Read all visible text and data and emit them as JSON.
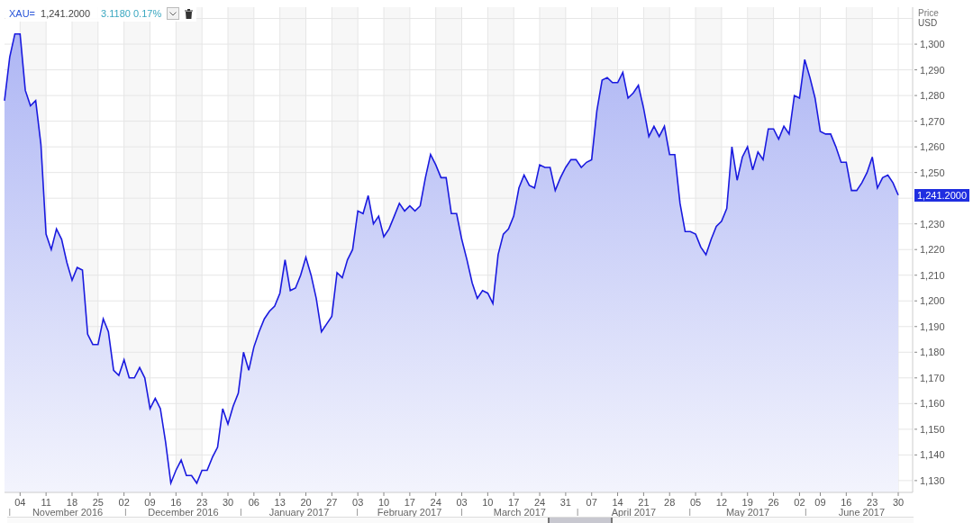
{
  "legend": {
    "price": "1,241.2000",
    "change": "3.1180 0.17%"
  },
  "price_axis": {
    "title": "Price",
    "unit": "USD"
  },
  "last_value_label": "1,241.2000",
  "chart_data": {
    "type": "area",
    "grid": true,
    "ylim": [
      1125.4,
      1314.4
    ],
    "categories": [
      null,
      null,
      null,
      "04",
      null,
      null,
      null,
      null,
      "11",
      null,
      null,
      null,
      null,
      "18",
      null,
      null,
      null,
      null,
      "25",
      null,
      null,
      null,
      null,
      "02",
      null,
      null,
      null,
      null,
      "09",
      null,
      null,
      null,
      null,
      "16",
      null,
      null,
      null,
      null,
      "23",
      null,
      null,
      null,
      null,
      "30",
      null,
      null,
      null,
      null,
      "06",
      null,
      null,
      null,
      null,
      "13",
      null,
      null,
      null,
      null,
      "20",
      null,
      null,
      null,
      null,
      "27",
      null,
      null,
      null,
      null,
      "03",
      null,
      null,
      null,
      null,
      "10",
      null,
      null,
      null,
      null,
      "17",
      null,
      null,
      null,
      null,
      "24",
      null,
      null,
      null,
      null,
      "03",
      null,
      null,
      null,
      null,
      "10",
      null,
      null,
      null,
      null,
      "17",
      null,
      null,
      null,
      null,
      "24",
      null,
      null,
      null,
      null,
      "31",
      null,
      null,
      null,
      null,
      "07",
      null,
      null,
      null,
      null,
      "14",
      null,
      null,
      null,
      null,
      "21",
      null,
      null,
      null,
      null,
      "28",
      null,
      null,
      null,
      null,
      "05",
      null,
      null,
      null,
      null,
      "12",
      null,
      null,
      null,
      null,
      "19",
      null,
      null,
      null,
      null,
      "26",
      null,
      null,
      null,
      null,
      "02",
      null,
      null,
      null,
      "09",
      null,
      null,
      null,
      null,
      "16",
      null,
      null,
      null,
      null,
      "23",
      null,
      null,
      null,
      null,
      "30"
    ],
    "series": [
      {
        "name": "XAU=",
        "color": "#1a1adf",
        "values": [
          1278,
          1295,
          1304,
          1304,
          1282,
          1276,
          1278,
          1261,
          1226,
          1220,
          1228,
          1224,
          1215,
          1208,
          1213,
          1212,
          1187,
          1183,
          1183,
          1193,
          1188,
          1173,
          1171,
          1177,
          1170,
          1170,
          1174,
          1170,
          1158,
          1162,
          1158,
          1145,
          1129,
          1134,
          1138,
          1132,
          1132,
          1129,
          1134,
          1134,
          1139,
          1143,
          1158,
          1152,
          1159,
          1164,
          1180,
          1173,
          1182,
          1188,
          1193,
          1196,
          1198,
          1203,
          1216,
          1204,
          1205,
          1210,
          1217,
          1210,
          1201,
          1188,
          1191,
          1194,
          1211,
          1209,
          1216,
          1220,
          1235,
          1234,
          1241,
          1230,
          1233,
          1225,
          1228,
          1233,
          1238,
          1235,
          1237,
          1235,
          1237,
          1248,
          1257,
          1253,
          1248,
          1248,
          1234,
          1234,
          1224,
          1216,
          1207,
          1201,
          1204,
          1203,
          1199,
          1218,
          1226,
          1228,
          1233,
          1244,
          1249,
          1245,
          1244,
          1253,
          1252,
          1252,
          1243,
          1248,
          1252,
          1255,
          1255,
          1252,
          1254,
          1255,
          1274,
          1286,
          1287,
          1285,
          1285,
          1289,
          1279,
          1281,
          1284,
          1275,
          1264,
          1268,
          1264,
          1268,
          1257,
          1257,
          1238,
          1227,
          1227,
          1226,
          1221,
          1218,
          1224,
          1229,
          1231,
          1236,
          1260,
          1247,
          1256,
          1260,
          1251,
          1258,
          1255,
          1267,
          1267,
          1263,
          1268,
          1265,
          1280,
          1279,
          1294,
          1287,
          1279,
          1266,
          1265,
          1265,
          1260,
          1254,
          1254,
          1243,
          1243,
          1246,
          1250,
          1256,
          1244,
          1248,
          1249,
          1246,
          1241.2
        ]
      }
    ],
    "yticks": [
      {
        "value": 1130,
        "label": "1,130"
      },
      {
        "value": 1140,
        "label": "1,140"
      },
      {
        "value": 1150,
        "label": "1,150"
      },
      {
        "value": 1160,
        "label": "1,160"
      },
      {
        "value": 1170,
        "label": "1,170"
      },
      {
        "value": 1180,
        "label": "1,180"
      },
      {
        "value": 1190,
        "label": "1,190"
      },
      {
        "value": 1200,
        "label": "1,200"
      },
      {
        "value": 1210,
        "label": "1,210"
      },
      {
        "value": 1220,
        "label": "1,220"
      },
      {
        "value": 1230,
        "label": "1,230"
      },
      {
        "value": 1250,
        "label": "1,250"
      },
      {
        "value": 1260,
        "label": "1,260"
      },
      {
        "value": 1270,
        "label": "1,270"
      },
      {
        "value": 1280,
        "label": "1,280"
      },
      {
        "value": 1290,
        "label": "1,290"
      },
      {
        "value": 1300,
        "label": "1,300"
      }
    ]
  },
  "months": [
    "November 2016",
    "December 2016",
    "January 2017",
    "February 2017",
    "March 2017",
    "April 2017",
    "May 2017",
    "June 2017"
  ]
}
